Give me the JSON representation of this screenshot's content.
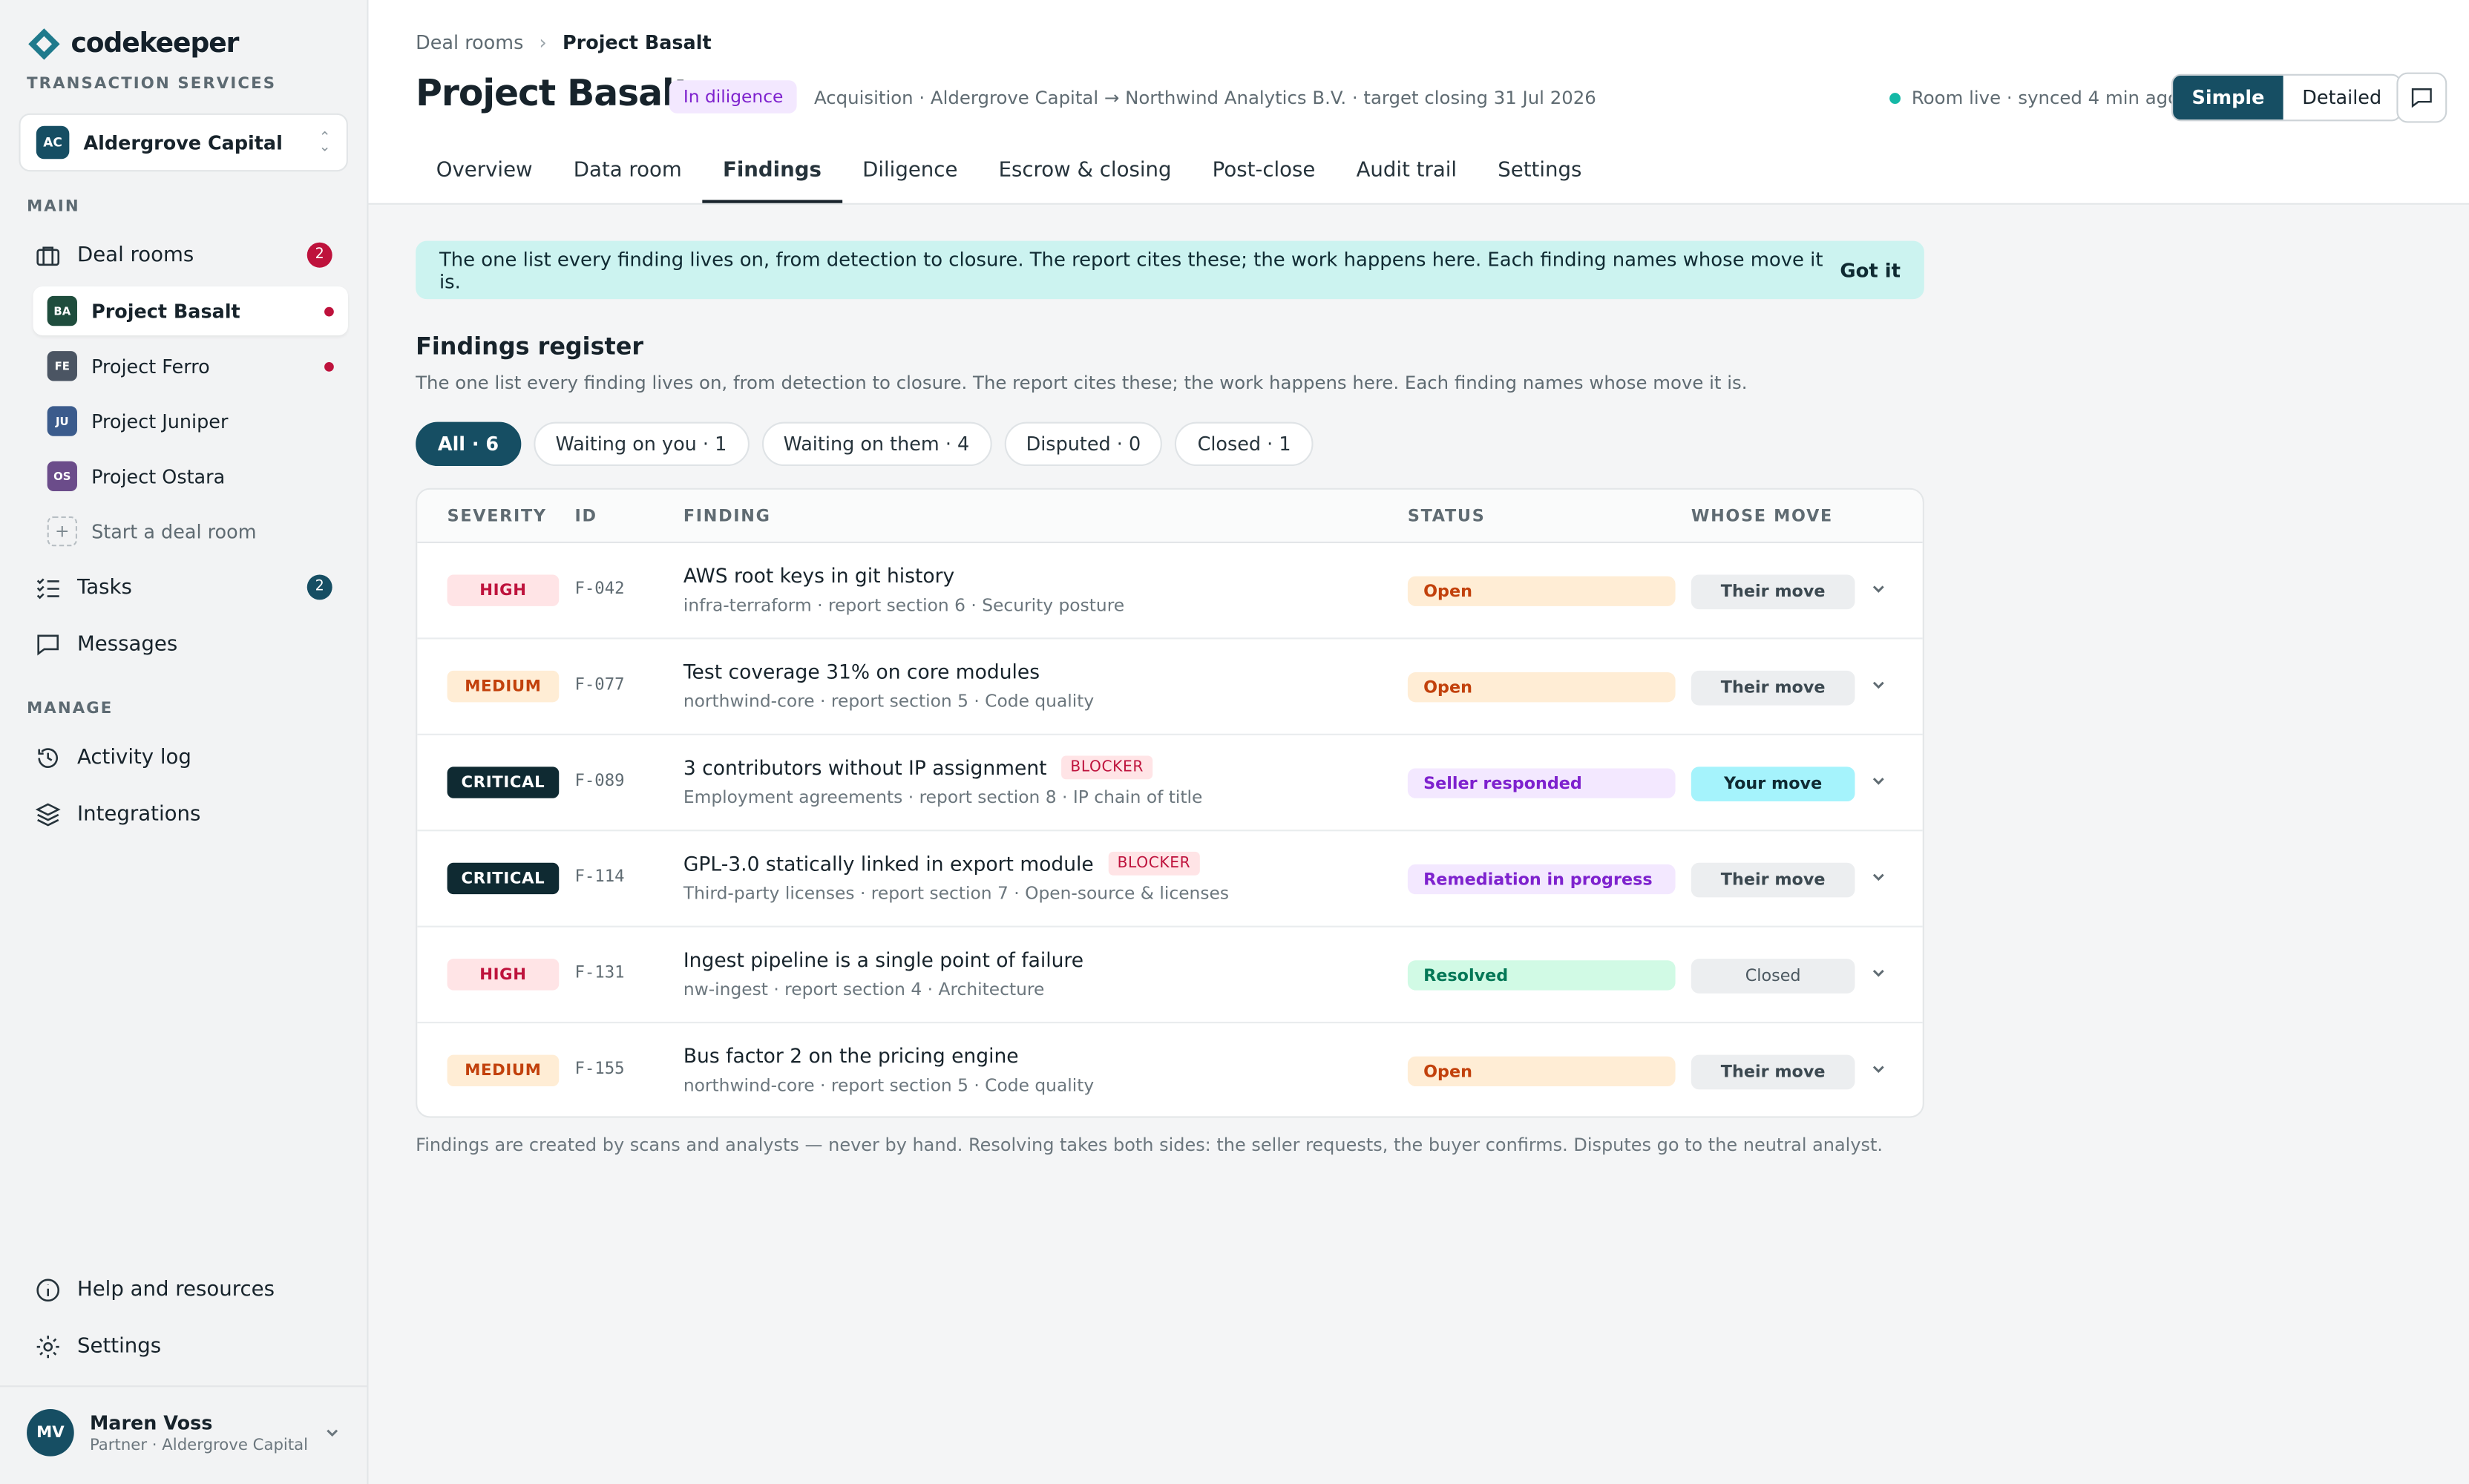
{
  "app": {
    "brand": "codekeeper",
    "brand_sub": "TRANSACTION SERVICES",
    "org": {
      "initials": "AC",
      "name": "Aldergrove Capital"
    }
  },
  "sidebar": {
    "main_label": "MAIN",
    "manage_label": "MANAGE",
    "deal_rooms": {
      "label": "Deal rooms",
      "count": "2"
    },
    "projects": [
      {
        "initials": "BA",
        "label": "Project Basalt",
        "color": "#1f4d3d",
        "dot": true
      },
      {
        "initials": "FE",
        "label": "Project Ferro",
        "color": "#4b5563",
        "dot": true
      },
      {
        "initials": "JU",
        "label": "Project Juniper",
        "color": "#3b5b8c",
        "dot": false
      },
      {
        "initials": "OS",
        "label": "Project Ostara",
        "color": "#6b4c8a",
        "dot": false
      }
    ],
    "start_room": "Start a deal room",
    "tasks": {
      "label": "Tasks",
      "count": "2"
    },
    "messages": "Messages",
    "activity": "Activity log",
    "integrations": "Integrations",
    "help": "Help and resources",
    "settings": "Settings",
    "user": {
      "initials": "MV",
      "name": "Maren Voss",
      "role": "Partner · Aldergrove Capital"
    }
  },
  "header": {
    "breadcrumb": [
      "Deal rooms",
      "Project Basalt"
    ],
    "title": "Project Basalt",
    "status": "In diligence",
    "meta": "Acquisition · Aldergrove Capital → Northwind Analytics B.V. · target closing 31 Jul 2026",
    "live": "Room live · synced 4 min ago",
    "view_simple": "Simple",
    "view_detailed": "Detailed",
    "tabs": [
      "Overview",
      "Data room",
      "Findings",
      "Diligence",
      "Escrow & closing",
      "Post-close",
      "Audit trail",
      "Settings"
    ],
    "active_tab": "Findings"
  },
  "banner": {
    "text": "The one list every finding lives on, from detection to closure. The report cites these; the work happens here. Each finding names whose move it is.",
    "action": "Got it"
  },
  "register": {
    "title": "Findings register",
    "subtitle": "The one list every finding lives on, from detection to closure. The report cites these; the work happens here. Each finding names whose move it is.",
    "filters": [
      "All · 6",
      "Waiting on you · 1",
      "Waiting on them · 4",
      "Disputed · 0",
      "Closed · 1"
    ],
    "columns": [
      "SEVERITY",
      "ID",
      "FINDING",
      "STATUS",
      "WHOSE MOVE"
    ],
    "rows": [
      {
        "severity": "HIGH",
        "id": "F-042",
        "title": "AWS root keys in git history",
        "blocker": "",
        "sub": "infra-terraform · report section 6 · Security posture",
        "status": "Open",
        "move": "Their move"
      },
      {
        "severity": "MEDIUM",
        "id": "F-077",
        "title": "Test coverage 31% on core modules",
        "blocker": "",
        "sub": "northwind-core · report section 5 · Code quality",
        "status": "Open",
        "move": "Their move"
      },
      {
        "severity": "CRITICAL",
        "id": "F-089",
        "title": "3 contributors without IP assignment",
        "blocker": "BLOCKER",
        "sub": "Employment agreements · report section 8 · IP chain of title",
        "status": "Seller responded",
        "move": "Your move"
      },
      {
        "severity": "CRITICAL",
        "id": "F-114",
        "title": "GPL-3.0 statically linked in export module",
        "blocker": "BLOCKER",
        "sub": "Third-party licenses · report section 7 · Open-source & licenses",
        "status": "Remediation in progress",
        "move": "Their move"
      },
      {
        "severity": "HIGH",
        "id": "F-131",
        "title": "Ingest pipeline is a single point of failure",
        "blocker": "",
        "sub": "nw-ingest · report section 4 · Architecture",
        "status": "Resolved",
        "move": "Closed"
      },
      {
        "severity": "MEDIUM",
        "id": "F-155",
        "title": "Bus factor 2 on the pricing engine",
        "blocker": "",
        "sub": "northwind-core · report section 5 · Code quality",
        "status": "Open",
        "move": "Their move"
      }
    ],
    "footnote": "Findings are created by scans and analysts — never by hand. Resolving takes both sides: the seller requests, the buyer confirms. Disputes go to the neutral analyst."
  },
  "colors": {
    "accent": "#164e63",
    "critical": "#0f2a32",
    "high_bg": "#ffe4e6",
    "high_fg": "#be123c",
    "medium_bg": "#ffedd5",
    "medium_fg": "#c2410c",
    "open_bg": "#ffedd5",
    "open_fg": "#c2410c",
    "purple_bg": "#f3e8ff",
    "purple_fg": "#7e22ce",
    "resolved_bg": "#d1fae5",
    "resolved_fg": "#047857",
    "your_move_bg": "#a5f3fc"
  }
}
